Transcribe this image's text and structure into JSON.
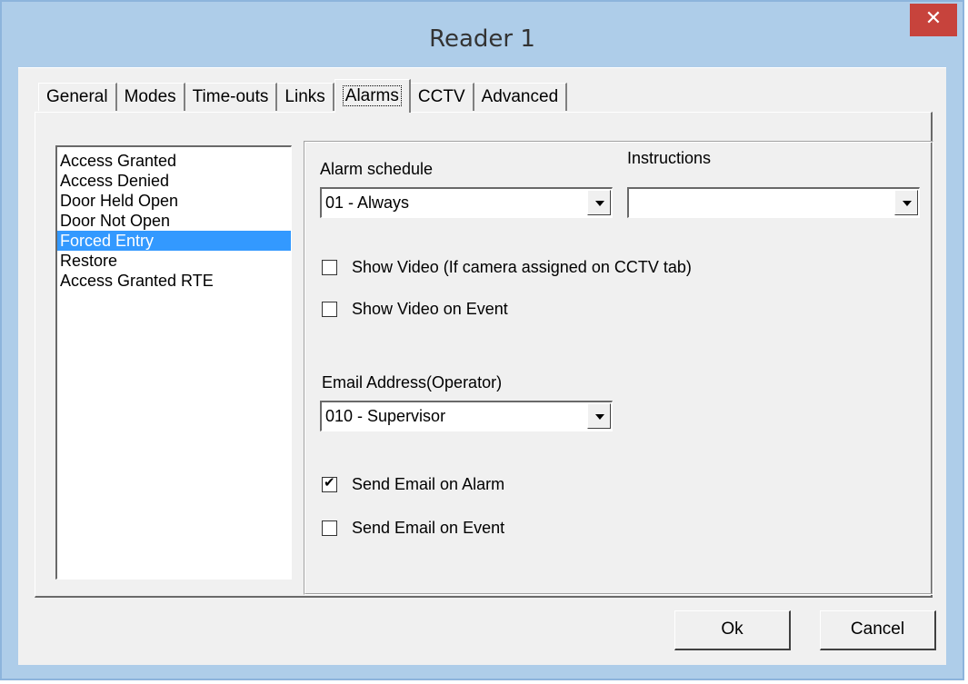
{
  "window": {
    "title": "Reader 1",
    "close_symbol": "✕"
  },
  "tabs": [
    "General",
    "Modes",
    "Time-outs",
    "Links",
    "Alarms",
    "CCTV",
    "Advanced"
  ],
  "active_tab": "Alarms",
  "event_list": [
    "Access Granted",
    "Access Denied",
    "Door Held Open",
    "Door Not Open",
    "Forced Entry",
    "Restore",
    "Access Granted RTE"
  ],
  "selected_event": "Forced Entry",
  "alarm": {
    "schedule_label": "Alarm schedule",
    "schedule_value": "01 - Always",
    "instructions_label": "Instructions",
    "instructions_value": "",
    "show_video_label": "Show Video (If camera assigned on CCTV tab)",
    "show_video_checked": false,
    "show_video_event_label": "Show Video on Event",
    "show_video_event_checked": false,
    "email_label": "Email Address(Operator)",
    "email_value": "010 - Supervisor",
    "send_alarm_label": "Send Email on Alarm",
    "send_alarm_checked": true,
    "send_event_label": "Send Email on Event",
    "send_event_checked": false
  },
  "buttons": {
    "ok": "Ok",
    "cancel": "Cancel"
  },
  "colors": {
    "frame": "#aecde9",
    "close": "#c7433c",
    "selection": "#3399ff",
    "face": "#f0f0f0"
  }
}
